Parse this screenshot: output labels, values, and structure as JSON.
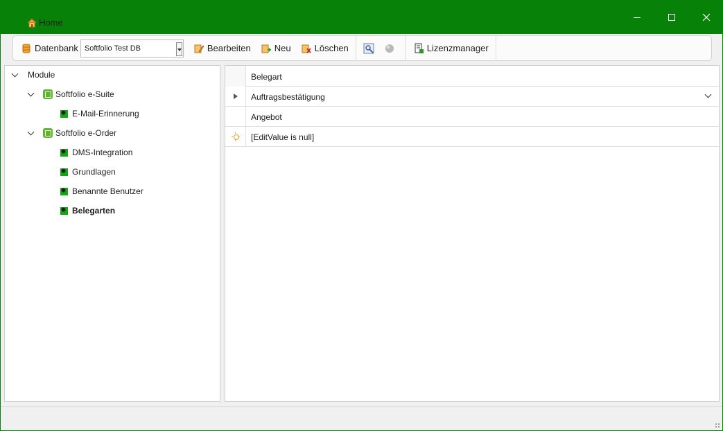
{
  "titlebar": {
    "home_label": "Home",
    "background_color": "#078107",
    "minimize_glyph": "—",
    "maximize_glyph": "☐",
    "close_glyph": "✕"
  },
  "toolbar": {
    "datenbank_label": "Datenbank",
    "database_selected": "Softfolio Test DB",
    "bearbeiten_label": "Bearbeiten",
    "neu_label": "Neu",
    "loeschen_label": "Löschen",
    "lizenzmanager_label": "Lizenzmanager",
    "icons": [
      "database-icon",
      "edit-icon",
      "new-icon",
      "delete-icon",
      "settings-tool-icon",
      "chat-icon",
      "license-icon"
    ]
  },
  "tree": {
    "root": "Module",
    "suite": "Softfolio e-Suite",
    "suite_items": [
      "E-Mail-Erinnerung"
    ],
    "order": "Softfolio e-Order",
    "order_items": [
      "DMS-Integration",
      "Grundlagen",
      "Benannte Benutzer",
      "Belegarten"
    ],
    "selected": "Belegarten"
  },
  "grid": {
    "column": "Belegart",
    "rows": [
      "Auftragsbestätigung",
      "Angebot"
    ],
    "new_row": "[EditValue is null]"
  }
}
